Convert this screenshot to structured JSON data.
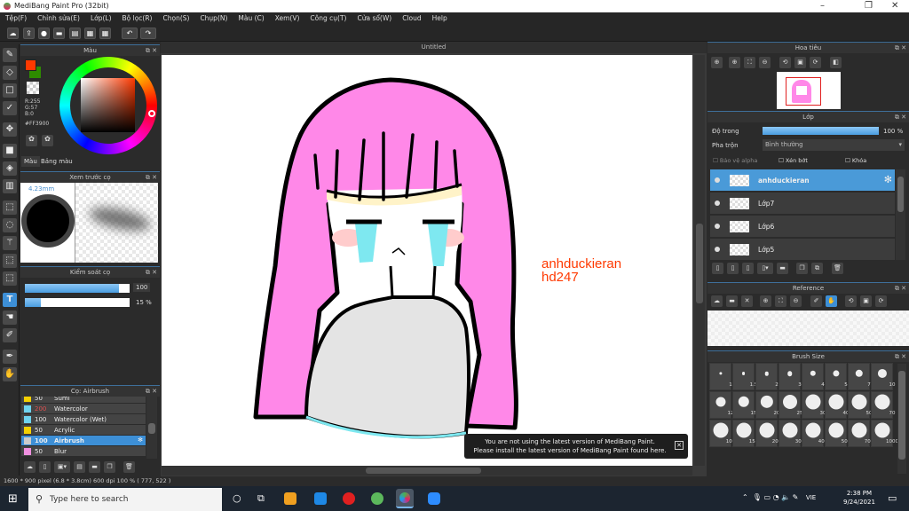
{
  "app": {
    "title": "MediBang Paint Pro (32bit)"
  },
  "menu": [
    "Tệp(F)",
    "Chỉnh sửa(E)",
    "Lớp(L)",
    "Bộ lọc(R)",
    "Chọn(S)",
    "Chụp(N)",
    "Màu (C)",
    "Xem(V)",
    "Công cụ(T)",
    "Cửa sổ(W)",
    "Cloud",
    "Help"
  ],
  "canvas": {
    "tab": "Untitled",
    "text_line1": "anhduckieran",
    "text_line2": "hd247",
    "text_color": "#FF3900"
  },
  "color_panel": {
    "title": "Màu",
    "r": "R:255",
    "g": "G:57",
    "b": "B:0",
    "hex": "#FF3900",
    "tabs": [
      "Màu",
      "Bảng màu"
    ],
    "foreground": "#FF3900",
    "background": "#2E8B00"
  },
  "brush_preview": {
    "title": "Xem trước cọ",
    "size": "4.23mm"
  },
  "brush_control": {
    "title": "Kiểm soát cọ",
    "size_value": "100",
    "opacity_value": "15 %",
    "size_fraction": 0.9,
    "opacity_fraction": 0.15
  },
  "brush_list": {
    "title": "Cọ: Airbrush",
    "items": [
      {
        "n": "50",
        "label": "Sumi",
        "color": "#f5d000"
      },
      {
        "n": "200",
        "label": "Watercolor",
        "color": "#6fd3f0"
      },
      {
        "n": "100",
        "label": "Watercolor (Wet)",
        "color": "#6fd3f0"
      },
      {
        "n": "50",
        "label": "Acrylic",
        "color": "#f5d000"
      },
      {
        "n": "100",
        "label": "Airbrush",
        "color": "#cccccc",
        "selected": true
      },
      {
        "n": "50",
        "label": "Blur",
        "color": "#f090e0"
      }
    ]
  },
  "navigator": {
    "title": "Hoa tiêu"
  },
  "layers": {
    "title": "Lớp",
    "opacity_label": "Độ trong",
    "opacity_value": "100 %",
    "blend_label": "Pha trộn",
    "blend_value": "Bình thường",
    "protect_alpha": "Bảo vệ alpha",
    "clipping": "Xén bớt",
    "lock": "Khóa",
    "items": [
      {
        "name": "anhduckieran",
        "selected": true
      },
      {
        "name": "Lớp7"
      },
      {
        "name": "Lớp6"
      },
      {
        "name": "Lớp5"
      }
    ]
  },
  "reference": {
    "title": "Reference"
  },
  "brush_size": {
    "title": "Brush Size",
    "sizes": [
      "1",
      "1.5",
      "2",
      "3",
      "4",
      "5",
      "7",
      "10",
      "12",
      "15",
      "20",
      "25",
      "30",
      "40",
      "50",
      "70",
      "100",
      "150",
      "200",
      "300",
      "400",
      "500",
      "700",
      "1000"
    ]
  },
  "notification": {
    "line1": "You are not using the latest version of MediBang Paint.",
    "line2": "Please install the latest version of MediBang Paint found here."
  },
  "status": {
    "text": "1600 * 900 pixel   (6.8 * 3.8cm)   600 dpi   100 %   ( 777, 522 )"
  },
  "taskbar": {
    "search_placeholder": "Type here to search",
    "lang": "VIE",
    "time": "2:38 PM",
    "date": "9/24/2021"
  }
}
